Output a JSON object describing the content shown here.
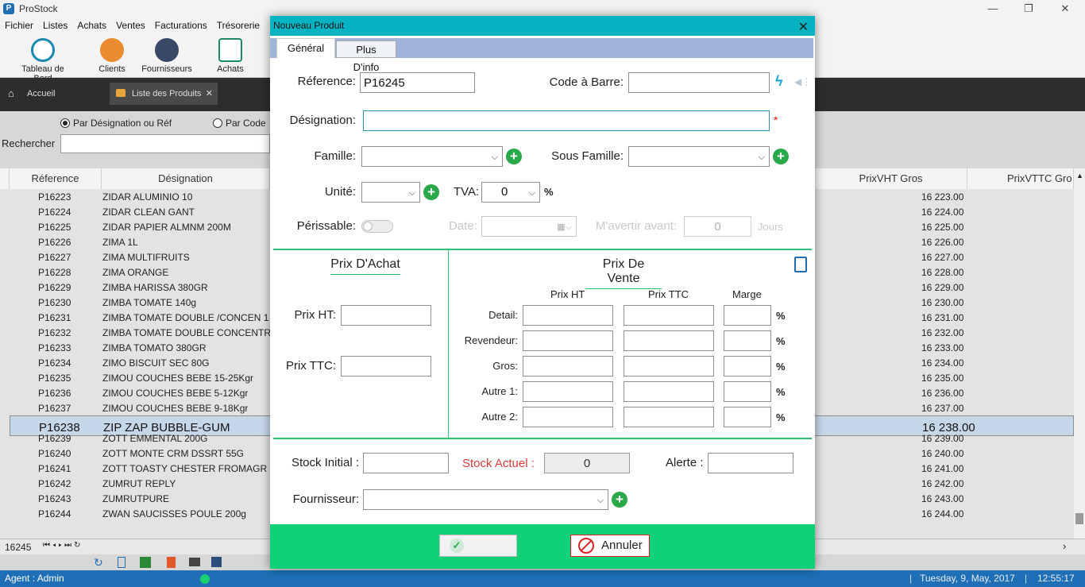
{
  "app": {
    "title": "ProStock"
  },
  "menu": [
    "Fichier",
    "Listes",
    "Achats",
    "Ventes",
    "Facturations",
    "Trésorerie"
  ],
  "toolbar": [
    "Tableau de Bord",
    "Clients",
    "Fournisseurs",
    "Achats"
  ],
  "tabs": {
    "home": "Accueil",
    "products": "Liste des Produits"
  },
  "search": {
    "radio1": "Par Désignation ou Réf",
    "radio2": "Par Code",
    "label": "Rechercher"
  },
  "grid": {
    "headers": {
      "ref": "Réference",
      "des": "Désignation",
      "pvht_gros": "PrixVHT Gros",
      "pvttc_gros": "PrixVTTC Gro"
    },
    "rows": [
      {
        "ref": "P16223",
        "des": "ZIDAR ALUMINIO  10",
        "price": "16 223.00"
      },
      {
        "ref": "P16224",
        "des": "ZIDAR CLEAN  GANT",
        "price": "16 224.00"
      },
      {
        "ref": "P16225",
        "des": "ZIDAR PAPIER ALMNM 200M",
        "price": "16 225.00"
      },
      {
        "ref": "P16226",
        "des": "ZIMA 1L",
        "price": "16 226.00"
      },
      {
        "ref": "P16227",
        "des": "ZIMA MULTIFRUITS",
        "price": "16 227.00"
      },
      {
        "ref": "P16228",
        "des": "ZIMA ORANGE",
        "price": "16 228.00"
      },
      {
        "ref": "P16229",
        "des": "ZIMBA HARISSA 380GR",
        "price": "16 229.00"
      },
      {
        "ref": "P16230",
        "des": "ZIMBA TOMATE 140g",
        "price": "16 230.00"
      },
      {
        "ref": "P16231",
        "des": "ZIMBA TOMATE DOUBLE /CONCEN 1",
        "price": "16 231.00"
      },
      {
        "ref": "P16232",
        "des": "ZIMBA TOMATE DOUBLE CONCENTR",
        "price": "16 232.00"
      },
      {
        "ref": "P16233",
        "des": "ZIMBA TOMATO 380GR",
        "price": "16 233.00"
      },
      {
        "ref": "P16234",
        "des": "ZIMO BISCUIT SEC 80G",
        "price": "16 234.00"
      },
      {
        "ref": "P16235",
        "des": "ZIMOU COUCHES BEBE 15-25Kgr",
        "price": "16 235.00"
      },
      {
        "ref": "P16236",
        "des": "ZIMOU COUCHES BEBE 5-12Kgr",
        "price": "16 236.00"
      },
      {
        "ref": "P16237",
        "des": "ZIMOU COUCHES BEBE 9-18Kgr",
        "price": "16 237.00"
      },
      {
        "ref": "P16238",
        "des": "ZIP ZAP BUBBLE-GUM",
        "price": "16 238.00"
      },
      {
        "ref": "P16239",
        "des": "ZOTT EMMENTAL 200G",
        "price": "16 239.00"
      },
      {
        "ref": "P16240",
        "des": "ZOTT MONTE CRM DSSRT 55G",
        "price": "16 240.00"
      },
      {
        "ref": "P16241",
        "des": "ZOTT TOASTY CHESTER FROMAGR",
        "price": "16 241.00"
      },
      {
        "ref": "P16242",
        "des": "ZUMRUT REPLY",
        "price": "16 242.00"
      },
      {
        "ref": "P16243",
        "des": "ZUMRUTPURE",
        "price": "16 243.00"
      },
      {
        "ref": "P16244",
        "des": "ZWAN SAUCISSES POULE 200g",
        "price": "16 244.00"
      }
    ],
    "selected_ref": "P16238",
    "count": "16245"
  },
  "status": {
    "agent": "Agent : Admin",
    "date": "Tuesday, 9,  May, 2017",
    "time": "12:55:17"
  },
  "modal": {
    "title": "Nouveau Produit",
    "tab_general": "Général",
    "tab_more": "Plus D'info",
    "reference_label": "Réference:",
    "reference_value": "P16245",
    "barcode_label": "Code à Barre:",
    "designation_label": "Désignation:",
    "required_mark": "*",
    "famille_label": "Famille:",
    "sous_famille_label": "Sous Famille:",
    "unite_label": "Unité:",
    "tva_label": "TVA:",
    "tva_value": "0",
    "pct": "%",
    "perissable_label": "Périssable:",
    "date_label": "Date:",
    "avertir_label": "M'avertir avant:",
    "avertir_value": "0",
    "jours_label": "Jours",
    "prix_achat_title": "Prix D'Achat",
    "prix_ht_label": "Prix HT:",
    "prix_ttc_label": "Prix TTC:",
    "prix_vente_title": "Prix De Vente",
    "col_ht": "Prix HT",
    "col_ttc": "Prix TTC",
    "col_marge": "Marge",
    "vente_rows": [
      "Detail:",
      "Revendeur:",
      "Gros:",
      "Autre 1:",
      "Autre 2:"
    ],
    "stock_initial_label": "Stock Initial :",
    "stock_actuel_label": "Stock Actuel :",
    "stock_actuel_value": "0",
    "alerte_label": "Alerte :",
    "fournisseur_label": "Fournisseur:",
    "cancel_label": "Annuler"
  },
  "colors": {
    "accent": "#06b3c3",
    "footer": "#10d178",
    "green": "#2fbf74",
    "status_bar": "#1e6fb5"
  }
}
